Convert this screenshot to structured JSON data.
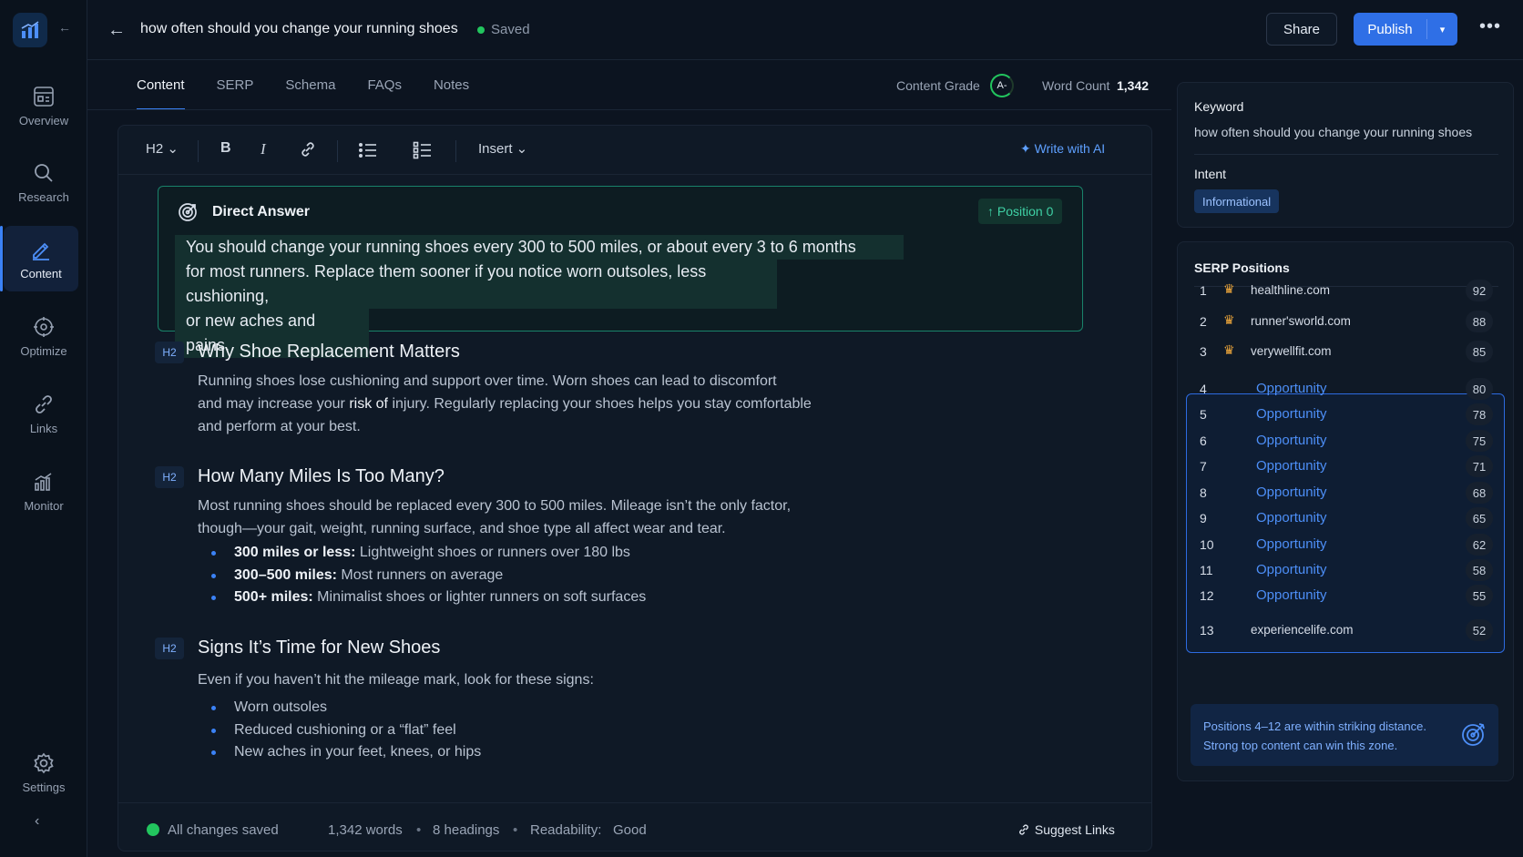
{
  "sidebar": {
    "items": [
      {
        "label": "Overview",
        "icon": "overview-icon"
      },
      {
        "label": "Research",
        "icon": "search-icon"
      },
      {
        "label": "Content",
        "icon": "pencil-icon",
        "active": true
      },
      {
        "label": "Optimize",
        "icon": "optimize-icon"
      },
      {
        "label": "Links",
        "icon": "link-icon"
      },
      {
        "label": "Monitor",
        "icon": "monitor-icon"
      }
    ],
    "settings_label": "Settings",
    "collapse_top": "←",
    "collapse_bottom": "‹"
  },
  "header": {
    "back": "←",
    "title": "how often should you change your running shoes",
    "saved": "Saved",
    "share": "Share",
    "publish": "Publish",
    "publish_caret": "▾",
    "more": "•••"
  },
  "tabs": [
    "Content",
    "SERP",
    "Schema",
    "FAQs",
    "Notes"
  ],
  "metrics": {
    "grade_label": "Content Grade",
    "grade_value": "A-",
    "word_count_label": "Word Count",
    "word_count_value": "1,342"
  },
  "toolbar": {
    "heading": "H2 ⌄",
    "bold": "B",
    "italic": "I",
    "insert": "Insert ⌄",
    "ai": "Write with AI"
  },
  "direct_answer": {
    "title": "Direct Answer",
    "badge": "↑ Position 0",
    "lines": [
      "You should change your running shoes every 300 to 500 miles, or about every 3 to 6 months",
      "for most runners. Replace them sooner if you notice worn outsoles, less cushioning,",
      "or new aches and pains."
    ]
  },
  "sections": [
    {
      "badge": "H2",
      "title": "Why Shoe Replacement Matters",
      "para_lines": [
        "Running shoes lose cushioning and support over time. Worn shoes can lead to discomfort",
        "and may increase your",
        "risk of",
        "injury. Regularly replacing your shoes helps you stay comfortable",
        "and perform at your best."
      ]
    },
    {
      "badge": "H2",
      "title": "How Many Miles Is Too Many?",
      "para_lines": [
        "Most running shoes should be replaced every 300 to 500 miles. Mileage isn’t the only factor,",
        "though—your gait, weight, running surface, and shoe type all affect wear and tear."
      ],
      "bullets": [
        {
          "bold": "300 miles or less:",
          "text": " Lightweight shoes or runners over 180 lbs"
        },
        {
          "bold": "300–500 miles:",
          "text": " Most runners on average"
        },
        {
          "bold": "500+ miles:",
          "text": " Minimalist shoes or lighter runners on soft surfaces"
        }
      ]
    },
    {
      "badge": "H2",
      "title": "Signs It’s Time for New Shoes",
      "para_lines": [
        "Even if you haven’t hit the mileage mark, look for these signs:"
      ],
      "bullets": [
        {
          "text": "Worn outsoles"
        },
        {
          "text": "Reduced cushioning or a “flat” feel"
        },
        {
          "text": "New aches in your feet, knees, or hips"
        }
      ]
    }
  ],
  "status": {
    "saved": "All changes saved",
    "words": "1,342 words",
    "headings": "8 headings",
    "readability_label": "Readability:",
    "readability_value": "Good",
    "sep": "•",
    "suggest": "Suggest Links"
  },
  "keyword_card": {
    "keyword_label": "Keyword",
    "keyword_value": "how often should you change your running shoes",
    "intent_label": "Intent",
    "intent_value": "Informational"
  },
  "serp": {
    "title": "SERP Positions",
    "rows": [
      {
        "pos": "1",
        "domain": "healthline.com",
        "score": "92",
        "crown": true
      },
      {
        "pos": "2",
        "domain": "runner'sworld.com",
        "score": "88",
        "crown": true
      },
      {
        "pos": "3",
        "domain": "verywellfit.com",
        "score": "85",
        "crown": true
      },
      {
        "pos": "4",
        "domain": "Opportunity",
        "score": "80",
        "opportunity": true
      },
      {
        "pos": "5",
        "domain": "Opportunity",
        "score": "78",
        "opportunity": true
      },
      {
        "pos": "6",
        "domain": "Opportunity",
        "score": "75",
        "opportunity": true
      },
      {
        "pos": "7",
        "domain": "Opportunity",
        "score": "71",
        "opportunity": true
      },
      {
        "pos": "8",
        "domain": "Opportunity",
        "score": "68",
        "opportunity": true
      },
      {
        "pos": "9",
        "domain": "Opportunity",
        "score": "65",
        "opportunity": true
      },
      {
        "pos": "10",
        "domain": "Opportunity",
        "score": "62",
        "opportunity": true
      },
      {
        "pos": "11",
        "domain": "Opportunity",
        "score": "58",
        "opportunity": true
      },
      {
        "pos": "12",
        "domain": "Opportunity",
        "score": "55",
        "opportunity": true
      },
      {
        "pos": "13",
        "domain": "experiencelife.com",
        "score": "52"
      }
    ],
    "crown_glyph": "♛",
    "tip_line1": "Positions 4–12 are within striking distance.",
    "tip_line2": "Strong top content can win this zone."
  },
  "colors": {
    "accent": "#3b82f6",
    "success": "#22c55e",
    "direct_answer_border": "#19826a",
    "crown": "#f2a93b"
  }
}
